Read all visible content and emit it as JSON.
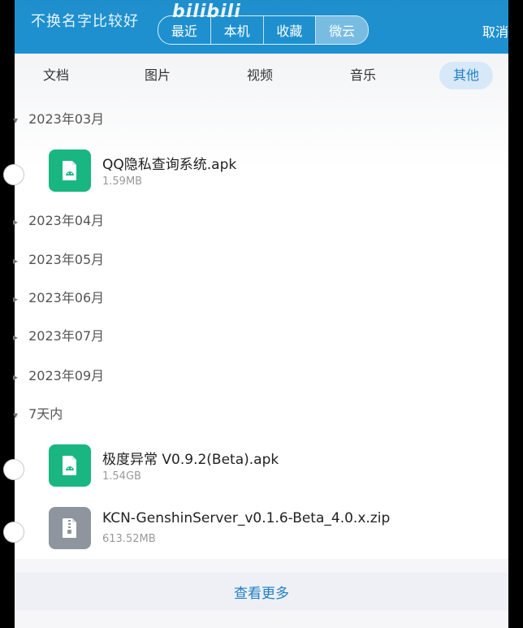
{
  "header": {
    "title": "不换名字比较好",
    "watermark": "bilibili",
    "segments": [
      "最近",
      "本机",
      "收藏",
      "微云"
    ],
    "active_segment": "微云",
    "cancel": "取消"
  },
  "tabs": [
    {
      "label": "文档"
    },
    {
      "label": "图片"
    },
    {
      "label": "视频"
    },
    {
      "label": "音乐"
    },
    {
      "label": "其他"
    }
  ],
  "active_tab": "其他",
  "groups": [
    {
      "label": "2023年03月",
      "expanded": true
    },
    {
      "label": "2023年04月",
      "expanded": false
    },
    {
      "label": "2023年05月",
      "expanded": false
    },
    {
      "label": "2023年06月",
      "expanded": false
    },
    {
      "label": "2023年07月",
      "expanded": false
    },
    {
      "label": "2023年09月",
      "expanded": false
    },
    {
      "label": "7天内",
      "expanded": true
    }
  ],
  "files": [
    {
      "name": "QQ隐私查询系统.apk",
      "size": "1.59MB",
      "type": "apk"
    },
    {
      "name": "极度异常 V0.9.2(Beta).apk",
      "size": "1.54GB",
      "type": "apk"
    },
    {
      "name": "KCN-GenshinServer_v0.1.6-Beta_4.0.x.zip",
      "size": "613.52MB",
      "type": "zip"
    }
  ],
  "more_button": "查看更多",
  "colors": {
    "header_blue": "#1e90d1",
    "accent": "#1e7fc5",
    "apk_green": "#19b682",
    "zip_gray": "#8e959e"
  },
  "icons": {
    "apk": "android-file-icon",
    "zip": "zip-file-icon",
    "group_collapsed": "triangle-right-icon",
    "group_expanded": "triangle-down-icon"
  }
}
